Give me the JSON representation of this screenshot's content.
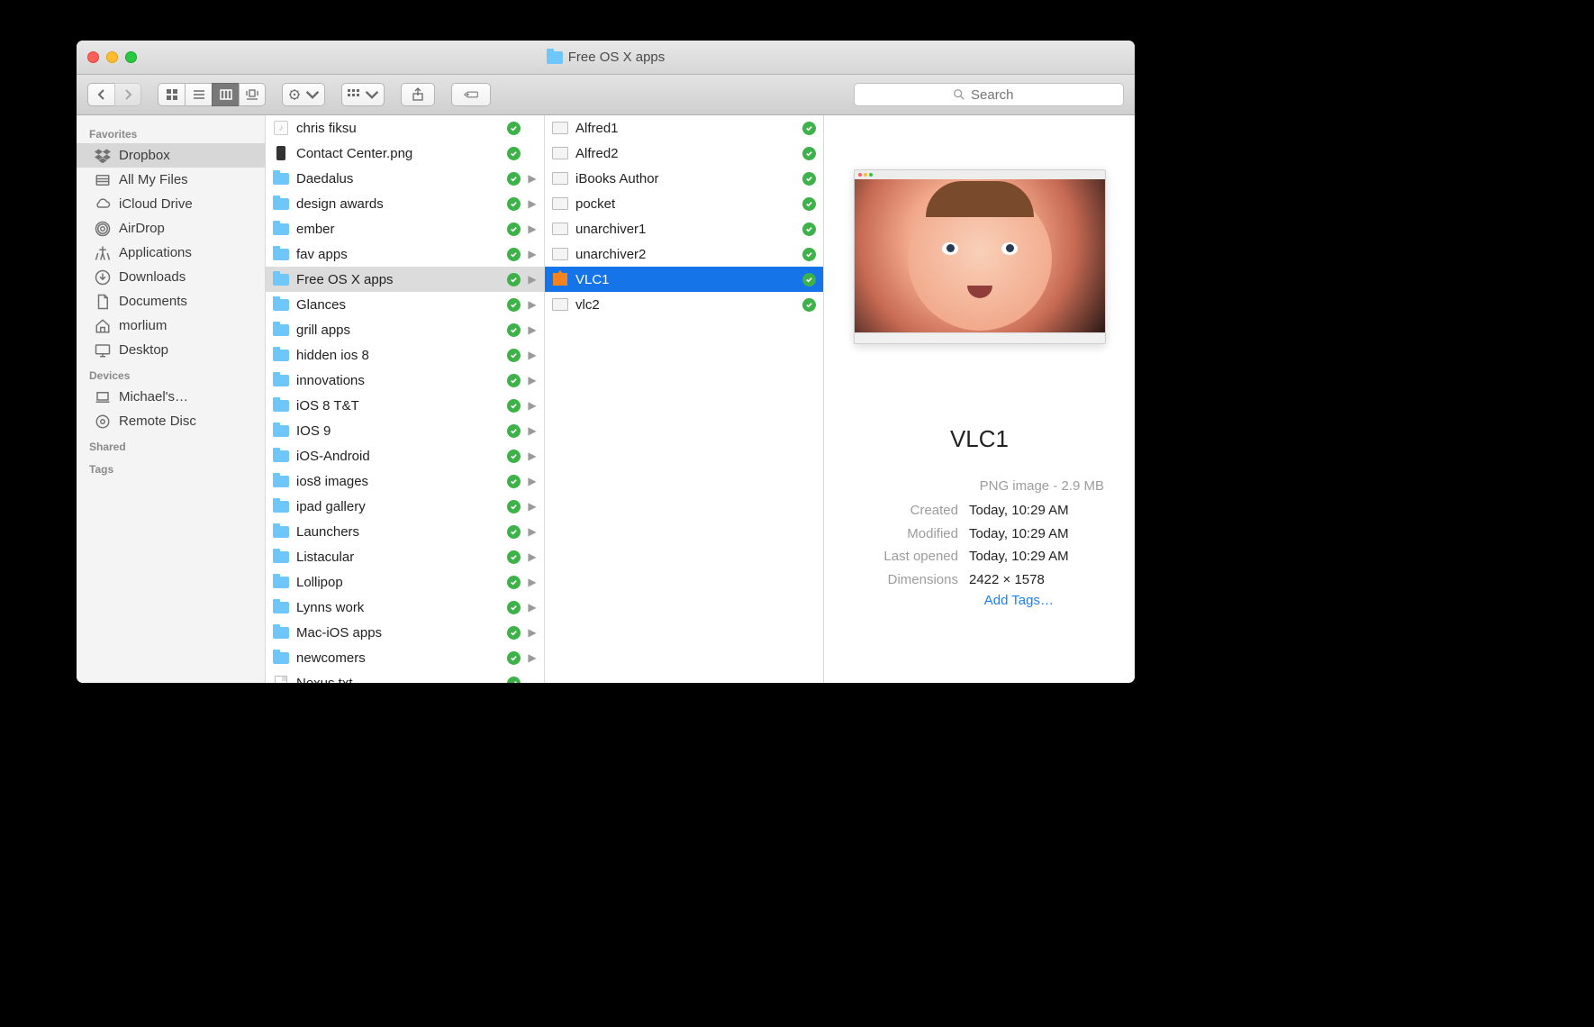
{
  "window": {
    "title": "Free OS X apps"
  },
  "search": {
    "placeholder": "Search"
  },
  "sidebar": {
    "sections": [
      {
        "header": "Favorites",
        "items": [
          {
            "icon": "dropbox",
            "label": "Dropbox",
            "selected": true
          },
          {
            "icon": "allfiles",
            "label": "All My Files"
          },
          {
            "icon": "cloud",
            "label": "iCloud Drive"
          },
          {
            "icon": "airdrop",
            "label": "AirDrop"
          },
          {
            "icon": "apps",
            "label": "Applications"
          },
          {
            "icon": "downloads",
            "label": "Downloads"
          },
          {
            "icon": "documents",
            "label": "Documents"
          },
          {
            "icon": "home",
            "label": "morlium"
          },
          {
            "icon": "desktop",
            "label": "Desktop"
          }
        ]
      },
      {
        "header": "Devices",
        "items": [
          {
            "icon": "laptop",
            "label": "Michael's…"
          },
          {
            "icon": "disc",
            "label": "Remote Disc"
          }
        ]
      },
      {
        "header": "Shared",
        "items": []
      },
      {
        "header": "Tags",
        "items": []
      }
    ]
  },
  "column1": [
    {
      "icon": "music",
      "name": "chris fiksu",
      "folder": false,
      "arrow": false
    },
    {
      "icon": "remote",
      "name": "Contact Center.png",
      "folder": false,
      "arrow": false
    },
    {
      "icon": "folder",
      "name": "Daedalus",
      "folder": true,
      "arrow": true
    },
    {
      "icon": "folder",
      "name": "design awards",
      "folder": true,
      "arrow": true
    },
    {
      "icon": "folder",
      "name": "ember",
      "folder": true,
      "arrow": true
    },
    {
      "icon": "folder",
      "name": "fav apps",
      "folder": true,
      "arrow": true
    },
    {
      "icon": "folder",
      "name": "Free OS X apps",
      "folder": true,
      "arrow": true,
      "selected": "mid"
    },
    {
      "icon": "folder",
      "name": "Glances",
      "folder": true,
      "arrow": true
    },
    {
      "icon": "folder",
      "name": "grill apps",
      "folder": true,
      "arrow": true
    },
    {
      "icon": "folder",
      "name": "hidden ios 8",
      "folder": true,
      "arrow": true
    },
    {
      "icon": "folder",
      "name": "innovations",
      "folder": true,
      "arrow": true
    },
    {
      "icon": "folder",
      "name": "iOS 8 T&T",
      "folder": true,
      "arrow": true
    },
    {
      "icon": "folder",
      "name": "IOS 9",
      "folder": true,
      "arrow": true
    },
    {
      "icon": "folder",
      "name": "iOS-Android",
      "folder": true,
      "arrow": true
    },
    {
      "icon": "folder",
      "name": "ios8 images",
      "folder": true,
      "arrow": true
    },
    {
      "icon": "folder",
      "name": "ipad gallery",
      "folder": true,
      "arrow": true
    },
    {
      "icon": "folder",
      "name": "Launchers",
      "folder": true,
      "arrow": true
    },
    {
      "icon": "folder",
      "name": "Listacular",
      "folder": true,
      "arrow": true
    },
    {
      "icon": "folder",
      "name": "Lollipop",
      "folder": true,
      "arrow": true
    },
    {
      "icon": "folder",
      "name": "Lynns work",
      "folder": true,
      "arrow": true
    },
    {
      "icon": "folder",
      "name": "Mac-iOS apps",
      "folder": true,
      "arrow": true
    },
    {
      "icon": "folder",
      "name": "newcomers",
      "folder": true,
      "arrow": true
    },
    {
      "icon": "txt",
      "name": "Nexus.txt",
      "folder": false,
      "arrow": false
    }
  ],
  "column2": [
    {
      "icon": "thumb",
      "name": "Alfred1"
    },
    {
      "icon": "thumb",
      "name": "Alfred2"
    },
    {
      "icon": "thumb",
      "name": "iBooks Author"
    },
    {
      "icon": "thumb",
      "name": "pocket"
    },
    {
      "icon": "thumb",
      "name": "unarchiver1"
    },
    {
      "icon": "thumb",
      "name": "unarchiver2"
    },
    {
      "icon": "vlc",
      "name": "VLC1",
      "selected": "blue"
    },
    {
      "icon": "thumb",
      "name": "vlc2"
    }
  ],
  "preview": {
    "name": "VLC1",
    "type": "PNG image - 2.9 MB",
    "meta": [
      {
        "k": "Created",
        "v": "Today, 10:29 AM"
      },
      {
        "k": "Modified",
        "v": "Today, 10:29 AM"
      },
      {
        "k": "Last opened",
        "v": "Today, 10:29 AM"
      },
      {
        "k": "Dimensions",
        "v": "2422 × 1578"
      }
    ],
    "add_tags": "Add Tags…"
  }
}
